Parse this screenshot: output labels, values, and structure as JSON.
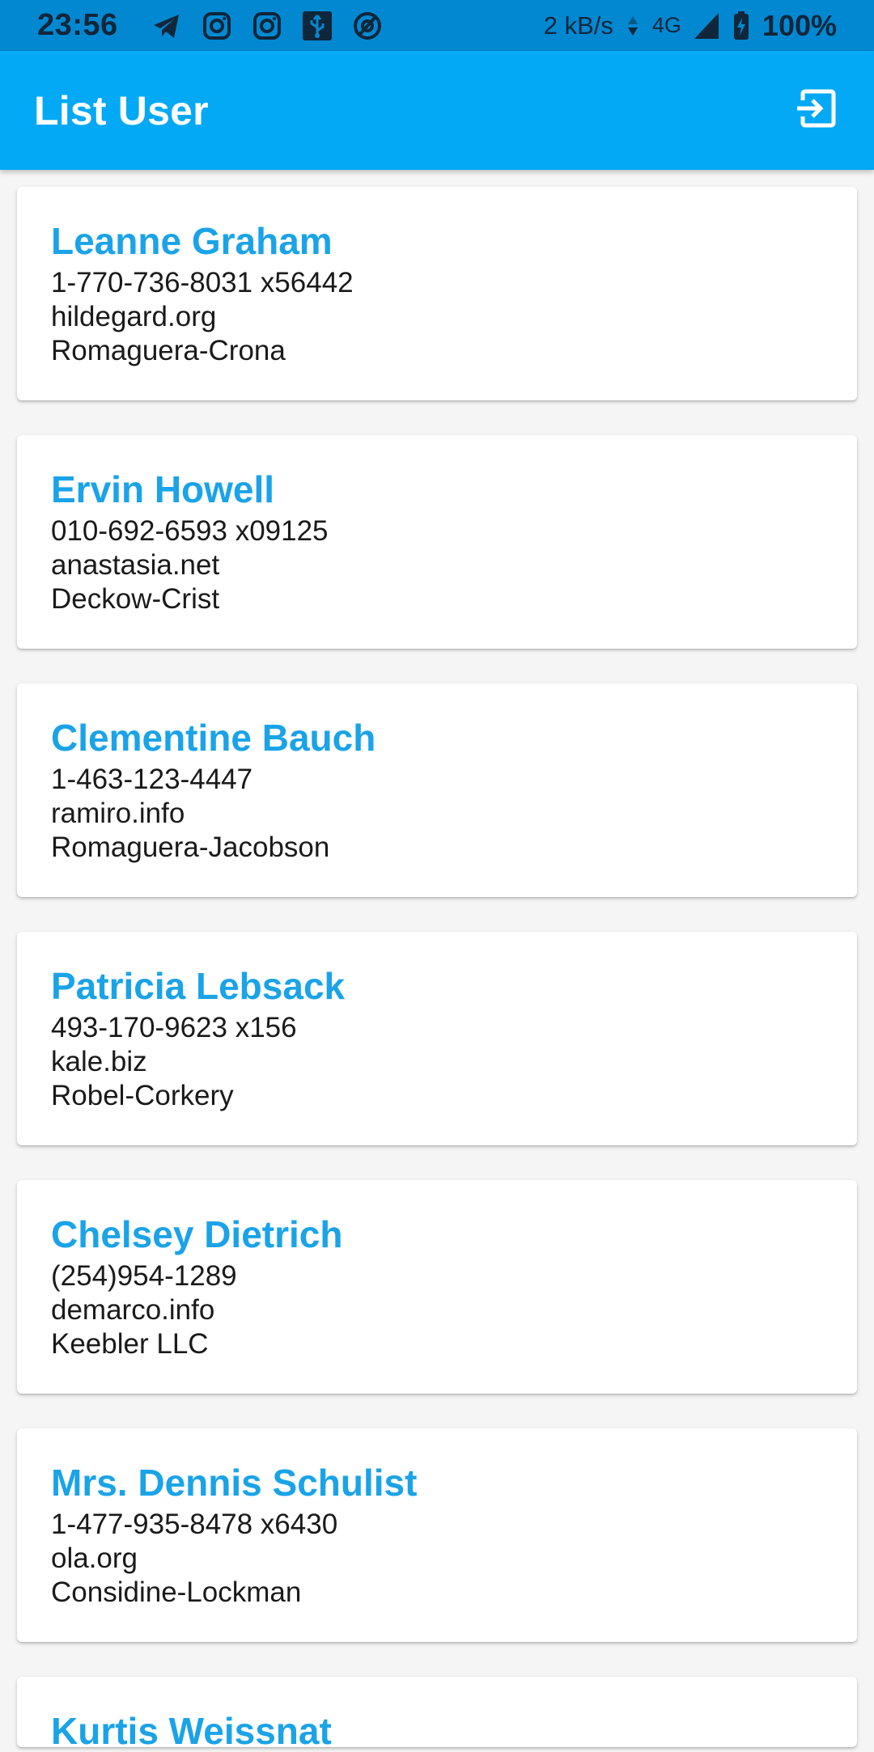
{
  "status_bar": {
    "time": "23:56",
    "speed": "2 kB/s",
    "network": "4G",
    "battery": "100%"
  },
  "app_bar": {
    "title": "List User",
    "action_icon": "logout-icon"
  },
  "users": [
    {
      "name": "Leanne Graham",
      "phone": "1-770-736-8031 x56442",
      "website": "hildegard.org",
      "company": "Romaguera-Crona"
    },
    {
      "name": "Ervin Howell",
      "phone": "010-692-6593 x09125",
      "website": "anastasia.net",
      "company": "Deckow-Crist"
    },
    {
      "name": "Clementine Bauch",
      "phone": "1-463-123-4447",
      "website": "ramiro.info",
      "company": "Romaguera-Jacobson"
    },
    {
      "name": "Patricia Lebsack",
      "phone": "493-170-9623 x156",
      "website": "kale.biz",
      "company": "Robel-Corkery"
    },
    {
      "name": "Chelsey Dietrich",
      "phone": "(254)954-1289",
      "website": "demarco.info",
      "company": "Keebler LLC"
    },
    {
      "name": "Mrs. Dennis Schulist",
      "phone": "1-477-935-8478 x6430",
      "website": "ola.org",
      "company": "Considine-Lockman"
    },
    {
      "name": "Kurtis Weissnat",
      "phone": "",
      "website": "",
      "company": ""
    }
  ],
  "colors": {
    "status_bar": "#0288d1",
    "app_bar": "#03a9f4",
    "name_text": "#1aa3e8",
    "background": "#f5f5f5"
  }
}
